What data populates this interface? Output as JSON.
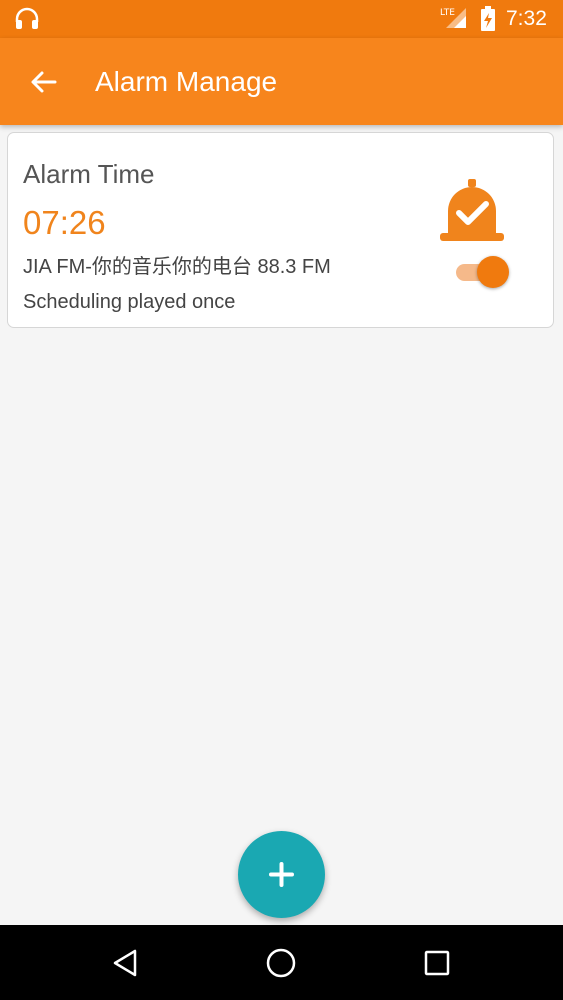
{
  "status_bar": {
    "time": "7:32",
    "network": "LTE",
    "icons": [
      "headphones-icon",
      "lte-signal-icon",
      "battery-charging-icon"
    ]
  },
  "app_bar": {
    "title": "Alarm Manage",
    "back_icon": "arrow-back-icon",
    "color": "#f7851c"
  },
  "alarm": {
    "label": "Alarm Time",
    "time": "07:26",
    "station": "JIA FM-你的音乐你的电台 88.3 FM",
    "schedule": "Scheduling played once",
    "enabled": true,
    "icon": "alarm-check-icon",
    "accent": "#f0841c"
  },
  "fab": {
    "icon": "plus-icon",
    "color": "#1aa8b2"
  },
  "nav_bar": {
    "buttons": [
      "back-triangle-icon",
      "home-circle-icon",
      "recents-square-icon"
    ]
  }
}
